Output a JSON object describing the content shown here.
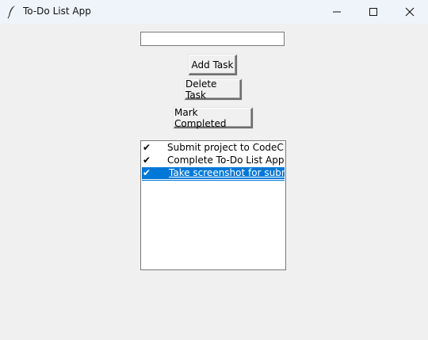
{
  "window": {
    "title": "To-Do List App",
    "icon": "feather-icon",
    "controls": [
      "minimize-icon",
      "maximize-icon",
      "close-icon"
    ]
  },
  "task_entry": {
    "value": ""
  },
  "buttons": {
    "add": "Add Task",
    "delete": "Delete Task",
    "mark": "Mark Completed"
  },
  "tasks": [
    {
      "check": "✔",
      "text": "Submit project to CodeClausе",
      "selected": false
    },
    {
      "check": "✔",
      "text": "Complete To-Do List App",
      "selected": false
    },
    {
      "check": "✔",
      "text": "Take screenshot for submission",
      "selected": true
    }
  ],
  "colors": {
    "selection": "#0078d7",
    "background": "#f0f0f0"
  }
}
